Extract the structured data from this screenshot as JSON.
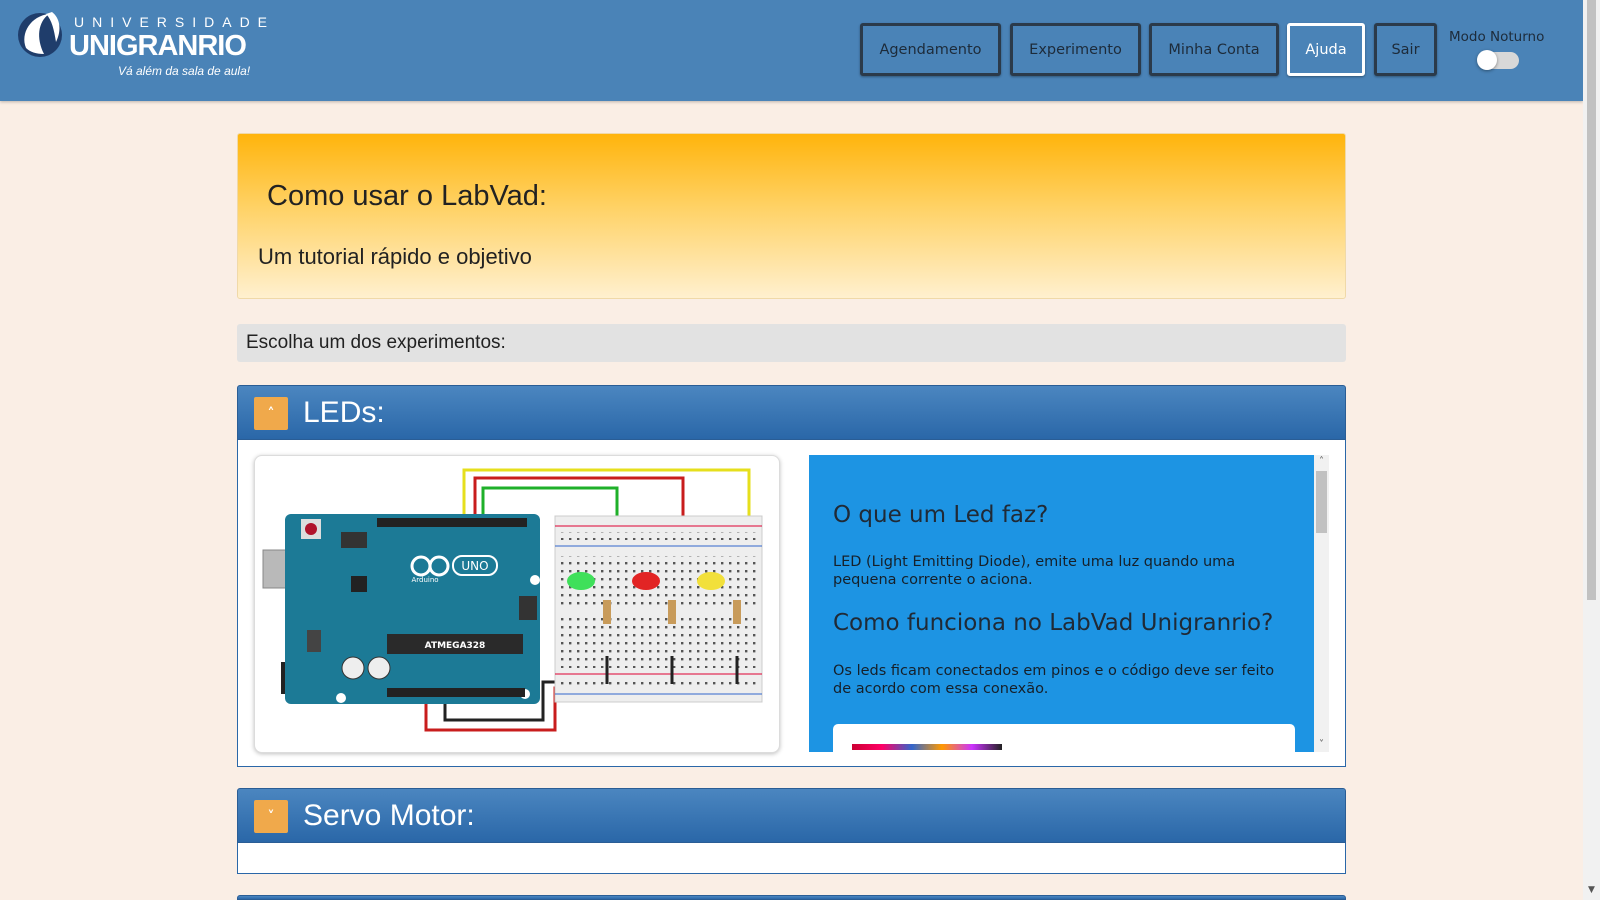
{
  "header": {
    "logo": {
      "top_text": "UNIVERSIDADE",
      "main_text": "UNIGRANRIO",
      "tagline": "Vá além da sala de aula!"
    },
    "nav": [
      "Agendamento",
      "Experimento",
      "Minha Conta",
      "Ajuda",
      "Sair"
    ],
    "active_nav": "Ajuda",
    "night_mode": {
      "label": "Modo Noturno",
      "enabled": false
    }
  },
  "hero": {
    "title": "Como usar o LabVad:",
    "subtitle": "Um tutorial rápido e objetivo"
  },
  "choose_label": "Escolha um dos experimentos:",
  "panels": [
    {
      "title": "LEDs:",
      "expanded": true,
      "image": {
        "board_label": "ATMEGA328",
        "board_brand": "UNO",
        "board_sub": "Arduino"
      },
      "info": {
        "heading1": "O que um Led faz?",
        "text1": "LED (Light Emitting Diode), emite uma luz quando uma pequena corrente o aciona.",
        "heading2": "Como funciona no LabVad Unigranrio?",
        "text2": "Os leds ficam conectados em pinos e o código deve ser feito de acordo com essa conexão."
      }
    },
    {
      "title": "Servo Motor:",
      "expanded": false
    }
  ],
  "colors": {
    "header_bg": "#4a83b7",
    "page_bg": "#faeee5",
    "panel_head": "#2a67a8",
    "toggle_btn": "#f0a94b",
    "info_bg": "#1d94e3"
  },
  "icons": {
    "expand_up": "chevron-up-icon",
    "expand_down": "chevron-down-icon"
  }
}
